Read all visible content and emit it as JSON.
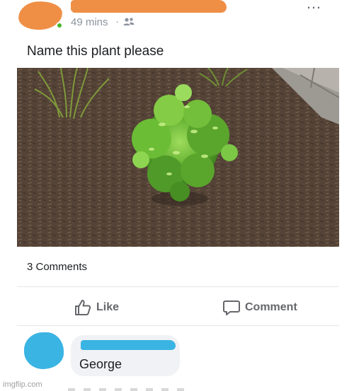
{
  "post": {
    "timestamp": "49 mins",
    "separator": "·",
    "audience_icon": "friends-icon",
    "more_icon": "more-options-icon",
    "caption": "Name this plant please",
    "photo_subject": "plant-photo"
  },
  "footer": {
    "comments_count": "3 Comments",
    "like_label": "Like",
    "comment_label": "Comment"
  },
  "comment": {
    "text": "George"
  },
  "watermark": "imgflip.com",
  "colors": {
    "redaction_orange": "#ef8f46",
    "redaction_blue": "#3ab4e3",
    "muted_text": "#8d949e",
    "action_text": "#65676b"
  }
}
